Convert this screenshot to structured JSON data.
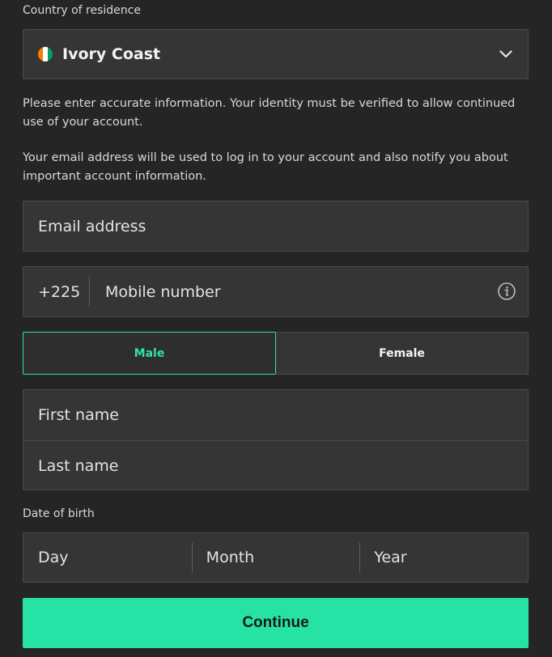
{
  "country": {
    "label": "Country of residence",
    "selected": "Ivory Coast",
    "flag_colors": [
      "#f77f00",
      "#ffffff",
      "#009e60"
    ]
  },
  "info": {
    "identity_notice": "Please enter accurate information. Your identity must be verified to allow continued use of your account.",
    "email_notice": "Your email address will be used to log in to your account and also notify you about important account information."
  },
  "email": {
    "placeholder": "Email address",
    "value": ""
  },
  "phone": {
    "prefix": "+225",
    "placeholder": "Mobile number",
    "value": ""
  },
  "gender": {
    "options": [
      "Male",
      "Female"
    ],
    "selected": "Male"
  },
  "name": {
    "first_placeholder": "First name",
    "last_placeholder": "Last name"
  },
  "dob": {
    "label": "Date of birth",
    "day_placeholder": "Day",
    "month_placeholder": "Month",
    "year_placeholder": "Year"
  },
  "actions": {
    "continue_label": "Continue"
  },
  "colors": {
    "accent": "#26e2a4",
    "background": "#252525",
    "field": "#353535"
  }
}
